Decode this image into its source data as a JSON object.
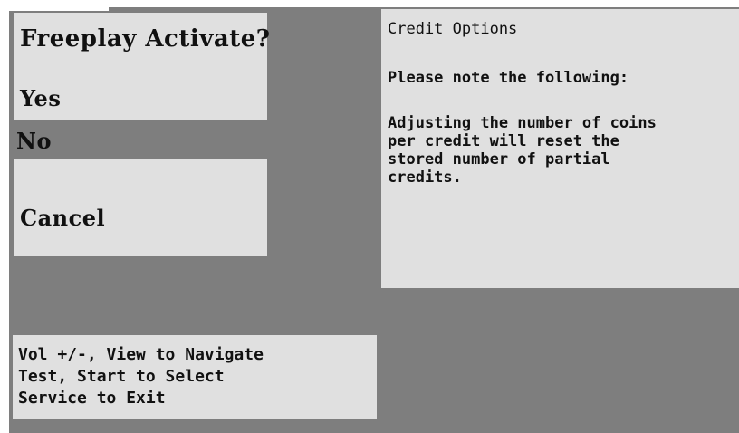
{
  "menu": {
    "title": "Freeplay Activate?",
    "items": [
      {
        "label": "Yes",
        "selected": false
      },
      {
        "label": "No",
        "selected": true
      },
      {
        "label": "Cancel",
        "selected": false
      }
    ]
  },
  "info": {
    "title": "Credit Options",
    "note": "Please note the following:",
    "body_lines": [
      "Adjusting the number of coins",
      "per credit will reset the",
      "stored number of partial",
      "credits."
    ]
  },
  "help": {
    "lines": [
      "Vol +/-, View to Navigate",
      "Test, Start to Select",
      "Service to Exit"
    ]
  },
  "colors": {
    "background": "#7e7e7e",
    "panel": "#e0e0e0",
    "selection": "#7e7e7e",
    "text": "#111111"
  }
}
